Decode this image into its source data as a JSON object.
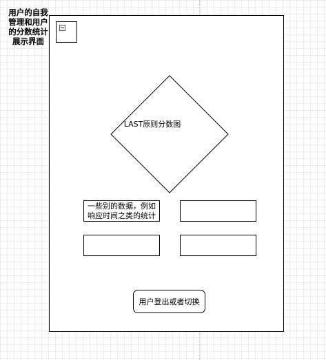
{
  "side_title": "用户的自我管理和用户的分数统计展示界面",
  "diagram": {
    "diamond_label": "LAST原则分数图",
    "stats": [
      {
        "label": "一些别的数据，例如响应时间之类的统计"
      },
      {
        "label": ""
      },
      {
        "label": ""
      },
      {
        "label": ""
      }
    ],
    "logout_button": "用户登出或者切换"
  },
  "icons": {
    "collapse": "collapse-icon"
  },
  "colors": {
    "stroke": "#000000",
    "grid": "#ececec",
    "background": "#ffffff"
  }
}
